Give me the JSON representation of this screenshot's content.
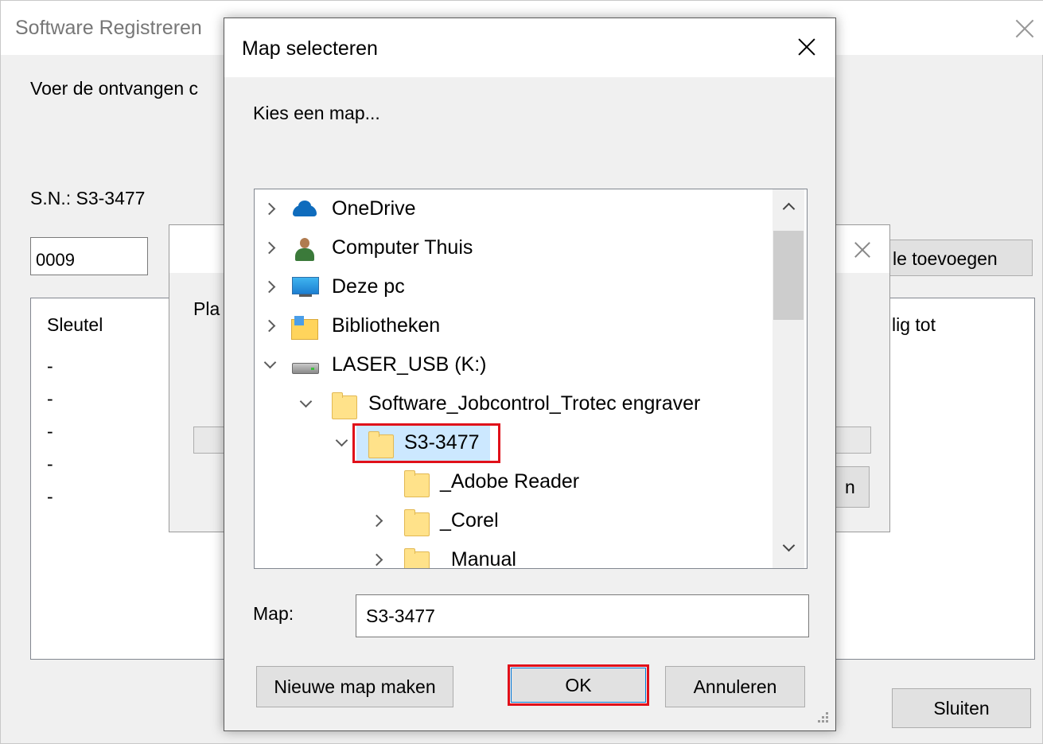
{
  "background_window": {
    "title": "Software Registreren",
    "instruction": "Voer de ontvangen c",
    "serial": "S.N.: S3-3477",
    "code_value": "0009",
    "add_button": "le toevoegen",
    "columns": {
      "key": "Sleutel",
      "valid_until": "lig tot"
    },
    "rows": [
      "-",
      "-",
      "-",
      "-",
      "-"
    ],
    "close_button": "Sluiten"
  },
  "middle_dialog": {
    "label": "Pla",
    "button": "n"
  },
  "folder_dialog": {
    "title": "Map selecteren",
    "prompt": "Kies een map...",
    "tree": [
      {
        "label": "OneDrive",
        "icon": "onedrive-icon",
        "expander": "collapsed"
      },
      {
        "label": "Computer Thuis",
        "icon": "user-icon",
        "expander": "collapsed"
      },
      {
        "label": "Deze pc",
        "icon": "pc-icon",
        "expander": "collapsed"
      },
      {
        "label": "Bibliotheken",
        "icon": "library-icon",
        "expander": "collapsed"
      },
      {
        "label": "LASER_USB (K:)",
        "icon": "usb-drive-icon",
        "expander": "expanded"
      },
      {
        "label": "Software_Jobcontrol_Trotec engraver",
        "icon": "folder-icon",
        "expander": "expanded"
      },
      {
        "label": "S3-3477",
        "icon": "folder-icon",
        "expander": "expanded",
        "selected": true
      },
      {
        "label": "_Adobe Reader",
        "icon": "folder-icon",
        "expander": "none"
      },
      {
        "label": "_Corel",
        "icon": "folder-icon",
        "expander": "collapsed"
      },
      {
        "label": "_Manual",
        "icon": "folder-icon",
        "expander": "collapsed"
      }
    ],
    "map_label": "Map:",
    "map_value": "S3-3477",
    "new_folder_button": "Nieuwe map maken",
    "ok_button": "OK",
    "cancel_button": "Annuleren"
  },
  "colors": {
    "highlight": "#e0101a",
    "selection": "#cce8ff",
    "focus": "#0078d7"
  }
}
